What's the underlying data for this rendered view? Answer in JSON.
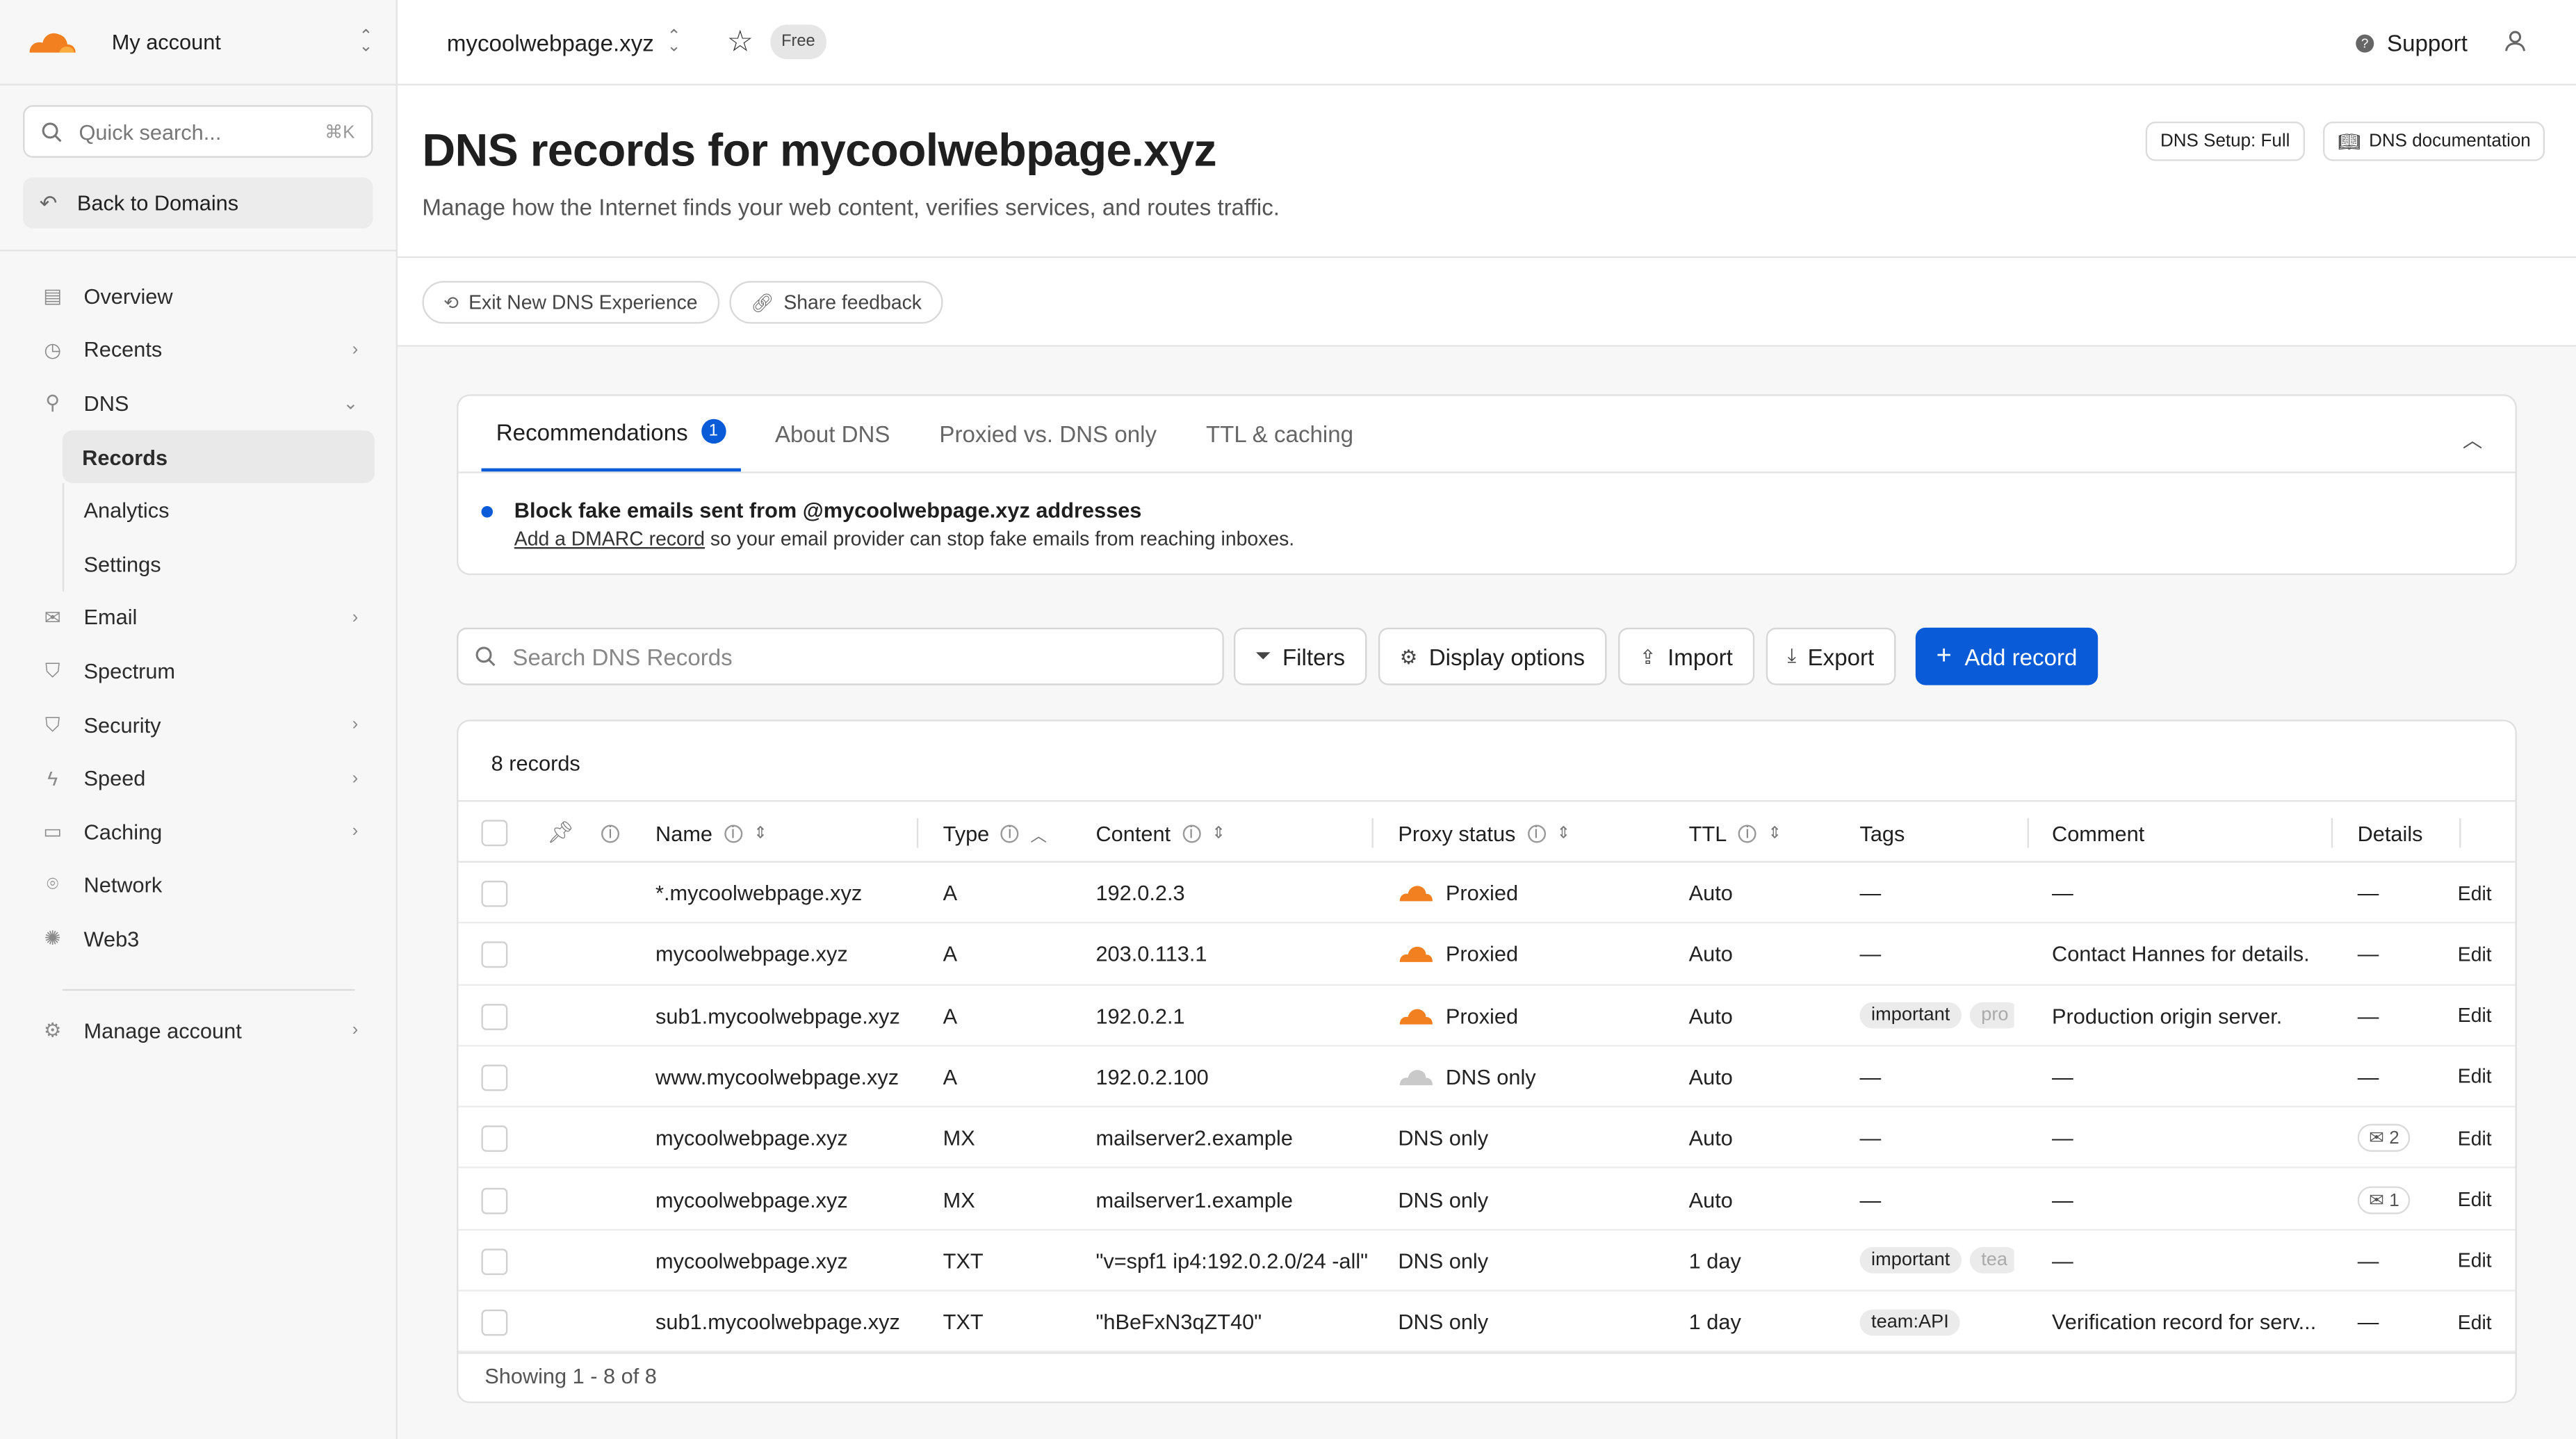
{
  "sidebar": {
    "account": "My account",
    "search_placeholder": "Quick search...",
    "search_shortcut": "⌘K",
    "back_label": "Back to Domains",
    "items": [
      {
        "label": "Overview"
      },
      {
        "label": "Recents"
      },
      {
        "label": "DNS"
      },
      {
        "label": "Records"
      },
      {
        "label": "Analytics"
      },
      {
        "label": "Settings"
      },
      {
        "label": "Email"
      },
      {
        "label": "Spectrum"
      },
      {
        "label": "Security"
      },
      {
        "label": "Speed"
      },
      {
        "label": "Caching"
      },
      {
        "label": "Network"
      },
      {
        "label": "Web3"
      }
    ],
    "manage_account": "Manage account"
  },
  "topbar": {
    "domain": "mycoolwebpage.xyz",
    "plan": "Free",
    "support": "Support"
  },
  "header": {
    "title": "DNS records for mycoolwebpage.xyz",
    "subtitle": "Manage how the Internet finds your web content, verifies services, and routes traffic.",
    "setup_chip": "DNS Setup: Full",
    "docs_chip": "DNS documentation",
    "exit_pill": "Exit New DNS Experience",
    "feedback_pill": "Share feedback"
  },
  "recommendations": {
    "tabs": [
      {
        "label": "Recommendations",
        "badge": "1"
      },
      {
        "label": "About DNS"
      },
      {
        "label": "Proxied vs. DNS only"
      },
      {
        "label": "TTL & caching"
      }
    ],
    "title": "Block fake emails sent from @mycoolwebpage.xyz addresses",
    "link": "Add a DMARC record",
    "text": " so your email provider can stop fake emails from reaching inboxes."
  },
  "toolbar": {
    "search_placeholder": "Search DNS Records",
    "filters": "Filters",
    "display": "Display options",
    "import": "Import",
    "export": "Export",
    "add": "Add record"
  },
  "table": {
    "count": "8 records",
    "headers": {
      "name": "Name",
      "type": "Type",
      "content": "Content",
      "proxy": "Proxy status",
      "ttl": "TTL",
      "tags": "Tags",
      "comment": "Comment",
      "details": "Details"
    },
    "rows": [
      {
        "name": "*.mycoolwebpage.xyz",
        "type": "A",
        "content": "192.0.2.3",
        "proxy": "Proxied",
        "ttl": "Auto",
        "tags": "—",
        "tag1": "",
        "tag2": "",
        "comment": "—",
        "details": "—",
        "edit": "Edit"
      },
      {
        "name": "mycoolwebpage.xyz",
        "type": "A",
        "content": "203.0.113.1",
        "proxy": "Proxied",
        "ttl": "Auto",
        "tags": "—",
        "tag1": "",
        "tag2": "",
        "comment": "Contact Hannes for details.",
        "details": "—",
        "edit": "Edit"
      },
      {
        "name": "sub1.mycoolwebpage.xyz",
        "type": "A",
        "content": "192.0.2.1",
        "proxy": "Proxied",
        "ttl": "Auto",
        "tags": "",
        "tag1": "important",
        "tag2": "pro",
        "comment": "Production origin server.",
        "details": "—",
        "edit": "Edit"
      },
      {
        "name": "www.mycoolwebpage.xyz",
        "type": "A",
        "content": "192.0.2.100",
        "proxy": "DNS only",
        "ttl": "Auto",
        "tags": "—",
        "tag1": "",
        "tag2": "",
        "comment": "—",
        "details": "—",
        "edit": "Edit"
      },
      {
        "name": "mycoolwebpage.xyz",
        "type": "MX",
        "content": "mailserver2.example",
        "proxy": "DNS only",
        "ttl": "Auto",
        "tags": "—",
        "tag1": "",
        "tag2": "",
        "comment": "—",
        "details": "2",
        "edit": "Edit"
      },
      {
        "name": "mycoolwebpage.xyz",
        "type": "MX",
        "content": "mailserver1.example",
        "proxy": "DNS only",
        "ttl": "Auto",
        "tags": "—",
        "tag1": "",
        "tag2": "",
        "comment": "—",
        "details": "1",
        "edit": "Edit"
      },
      {
        "name": "mycoolwebpage.xyz",
        "type": "TXT",
        "content": "\"v=spf1 ip4:192.0.2.0/24 -all\"",
        "proxy": "DNS only",
        "ttl": "1 day",
        "tags": "",
        "tag1": "important",
        "tag2": "tea",
        "comment": "—",
        "details": "—",
        "edit": "Edit"
      },
      {
        "name": "sub1.mycoolwebpage.xyz",
        "type": "TXT",
        "content": "\"hBeFxN3qZT40\"",
        "proxy": "DNS only",
        "ttl": "1 day",
        "tags": "",
        "tag1": "team:API",
        "tag2": "",
        "comment": "Verification record for serv...",
        "details": "—",
        "edit": "Edit"
      }
    ],
    "footer": "Showing 1 - 8 of 8"
  },
  "colors": {
    "accent": "#0a5bd8",
    "proxied_cloud": "#f38020",
    "dns_only_cloud": "#c9c9c9"
  },
  "icons": [
    "cloudflare-logo",
    "search-icon",
    "back-arrow-icon",
    "star-icon",
    "help-icon",
    "user-icon",
    "filter-icon",
    "gear-icon",
    "upload-icon",
    "download-icon",
    "plus-icon",
    "cloud-icon",
    "pin-icon",
    "info-icon"
  ]
}
